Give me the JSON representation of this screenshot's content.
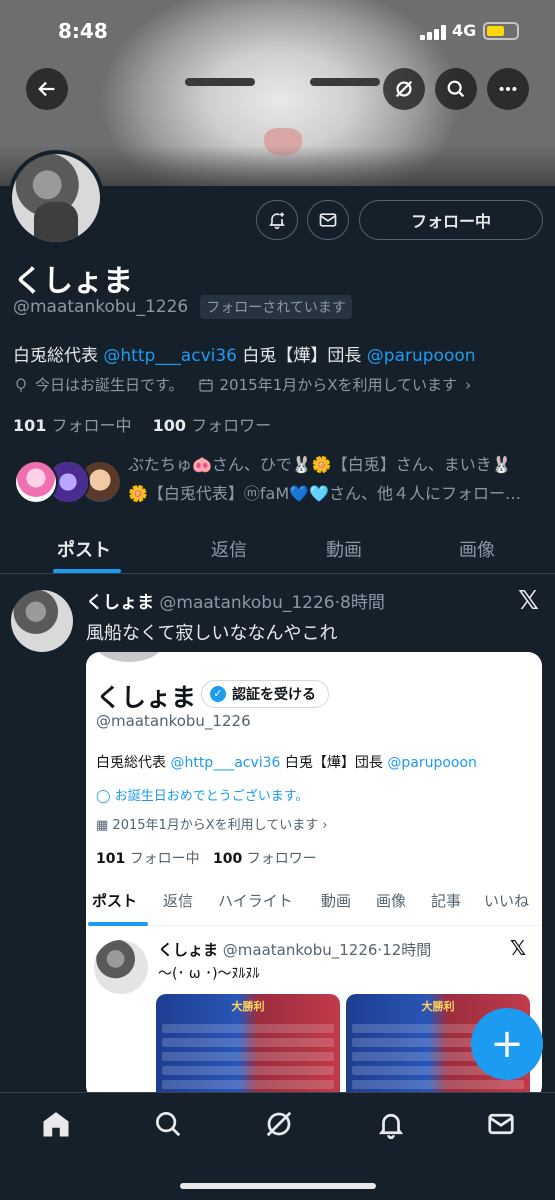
{
  "status_bar": {
    "time": "8:48",
    "network": "4G"
  },
  "profile": {
    "name": "くしょま",
    "handle": "@maatankobu_1226",
    "follows_you": "フォローされています",
    "bio": {
      "prefix": "白兎総代表 ",
      "mention1": "@http___acvi36",
      "middle": " 白兎【燁】団長 ",
      "mention2": "@parupooon"
    },
    "birthday": "今日はお誕生日です。",
    "joined": "2015年1月からXを利用しています",
    "following_count": "101",
    "following_label": "フォロー中",
    "followers_count": "100",
    "followers_label": "フォロワー",
    "followed_by_line1": "ぶたちゅ🐽さん、ひで🐰🌼【白兎】さん、まいき🐰",
    "followed_by_line2": "🌼【白兎代表】ⓜfaM💙🩵さん、他４人にフォロー…"
  },
  "actions": {
    "follow_button": "フォロー中"
  },
  "tabs": [
    "ポスト",
    "返信",
    "動画",
    "画像"
  ],
  "post": {
    "name": "くしょま",
    "handle": "@maatankobu_1226",
    "sep": "·",
    "time": "8時間",
    "text": "風船なくて寂しいななんやこれ",
    "x_glyph": "𝕏"
  },
  "embedded": {
    "name": "くしょま",
    "verify_label": "認証を受ける",
    "handle": "@maatankobu_1226",
    "bio_prefix": "白兎総代表 ",
    "bio_mention1": "@http___acvi36",
    "bio_middle": " 白兎【燁】団長 ",
    "bio_mention2": "@parupooon",
    "birthday": "お誕生日おめでとうございます。",
    "joined": "2015年1月からXを利用しています",
    "following_count": "101",
    "following_label": "フォロー中",
    "followers_count": "100",
    "followers_label": "フォロワー",
    "tabs": [
      "ポスト",
      "返信",
      "ハイライト",
      "動画",
      "画像",
      "記事",
      "いいね"
    ],
    "post_name": "くしょま",
    "post_meta": "@maatankobu_1226·12時間",
    "post_text": "〜(･ ω ･)〜ﾇﾙﾇﾙ",
    "image_title": "大勝利"
  },
  "colors": {
    "background": "#15202b",
    "accent": "#1d9bf0",
    "muted": "#8b98a5",
    "border": "#38444d"
  }
}
